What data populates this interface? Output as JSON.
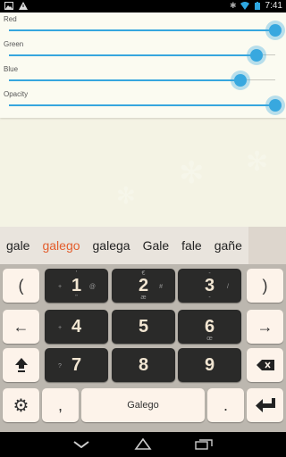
{
  "status_bar": {
    "time": "7:41",
    "left_icons": [
      "gallery-icon",
      "alert-icon"
    ],
    "right_icons": [
      "bluetooth-icon",
      "wifi-icon",
      "battery-icon"
    ]
  },
  "sliders": [
    {
      "label": "Red",
      "value": 1.0
    },
    {
      "label": "Green",
      "value": 0.93
    },
    {
      "label": "Blue",
      "value": 0.87
    },
    {
      "label": "Opacity",
      "value": 1.0
    }
  ],
  "suggestions": [
    {
      "text": "gale",
      "highlight": false
    },
    {
      "text": "galego",
      "highlight": true
    },
    {
      "text": "galega",
      "highlight": false
    },
    {
      "text": "Gale",
      "highlight": false
    },
    {
      "text": "fale",
      "highlight": false
    },
    {
      "text": "gañe",
      "highlight": false
    }
  ],
  "keyboard": {
    "left_col": {
      "row1": "(",
      "row2": "←"
    },
    "right_col": {
      "row1": ")",
      "row2": "→"
    },
    "numpad": [
      {
        "main": "1",
        "left": "+",
        "right": "@",
        "top": "'",
        "bottom": "\""
      },
      {
        "main": "2",
        "left": "",
        "right": "#",
        "top": "€",
        "bottom": "æ"
      },
      {
        "main": "3",
        "left": "",
        "right": "/",
        "top": "-",
        "bottom": "-"
      },
      {
        "main": "4",
        "left": "+",
        "right": "",
        "top": "",
        "bottom": ""
      },
      {
        "main": "5",
        "left": "",
        "right": "",
        "top": "",
        "bottom": ""
      },
      {
        "main": "6",
        "left": "",
        "right": "",
        "top": "",
        "bottom": "œ"
      },
      {
        "main": "7",
        "left": "?",
        "right": "",
        "top": "",
        "bottom": ""
      },
      {
        "main": "8",
        "left": "",
        "right": "",
        "top": "",
        "bottom": ""
      },
      {
        "main": "9",
        "left": "",
        "right": "",
        "top": "",
        "bottom": ""
      }
    ],
    "comma": ",",
    "space_label": "Galego",
    "period": "."
  },
  "colors": {
    "accent": "#38a8df",
    "suggestion_highlight": "#e35d2c",
    "keyboard_bg": "#bcb7af",
    "key_light": "#fdf3ea",
    "key_dark": "#2a2a29"
  }
}
